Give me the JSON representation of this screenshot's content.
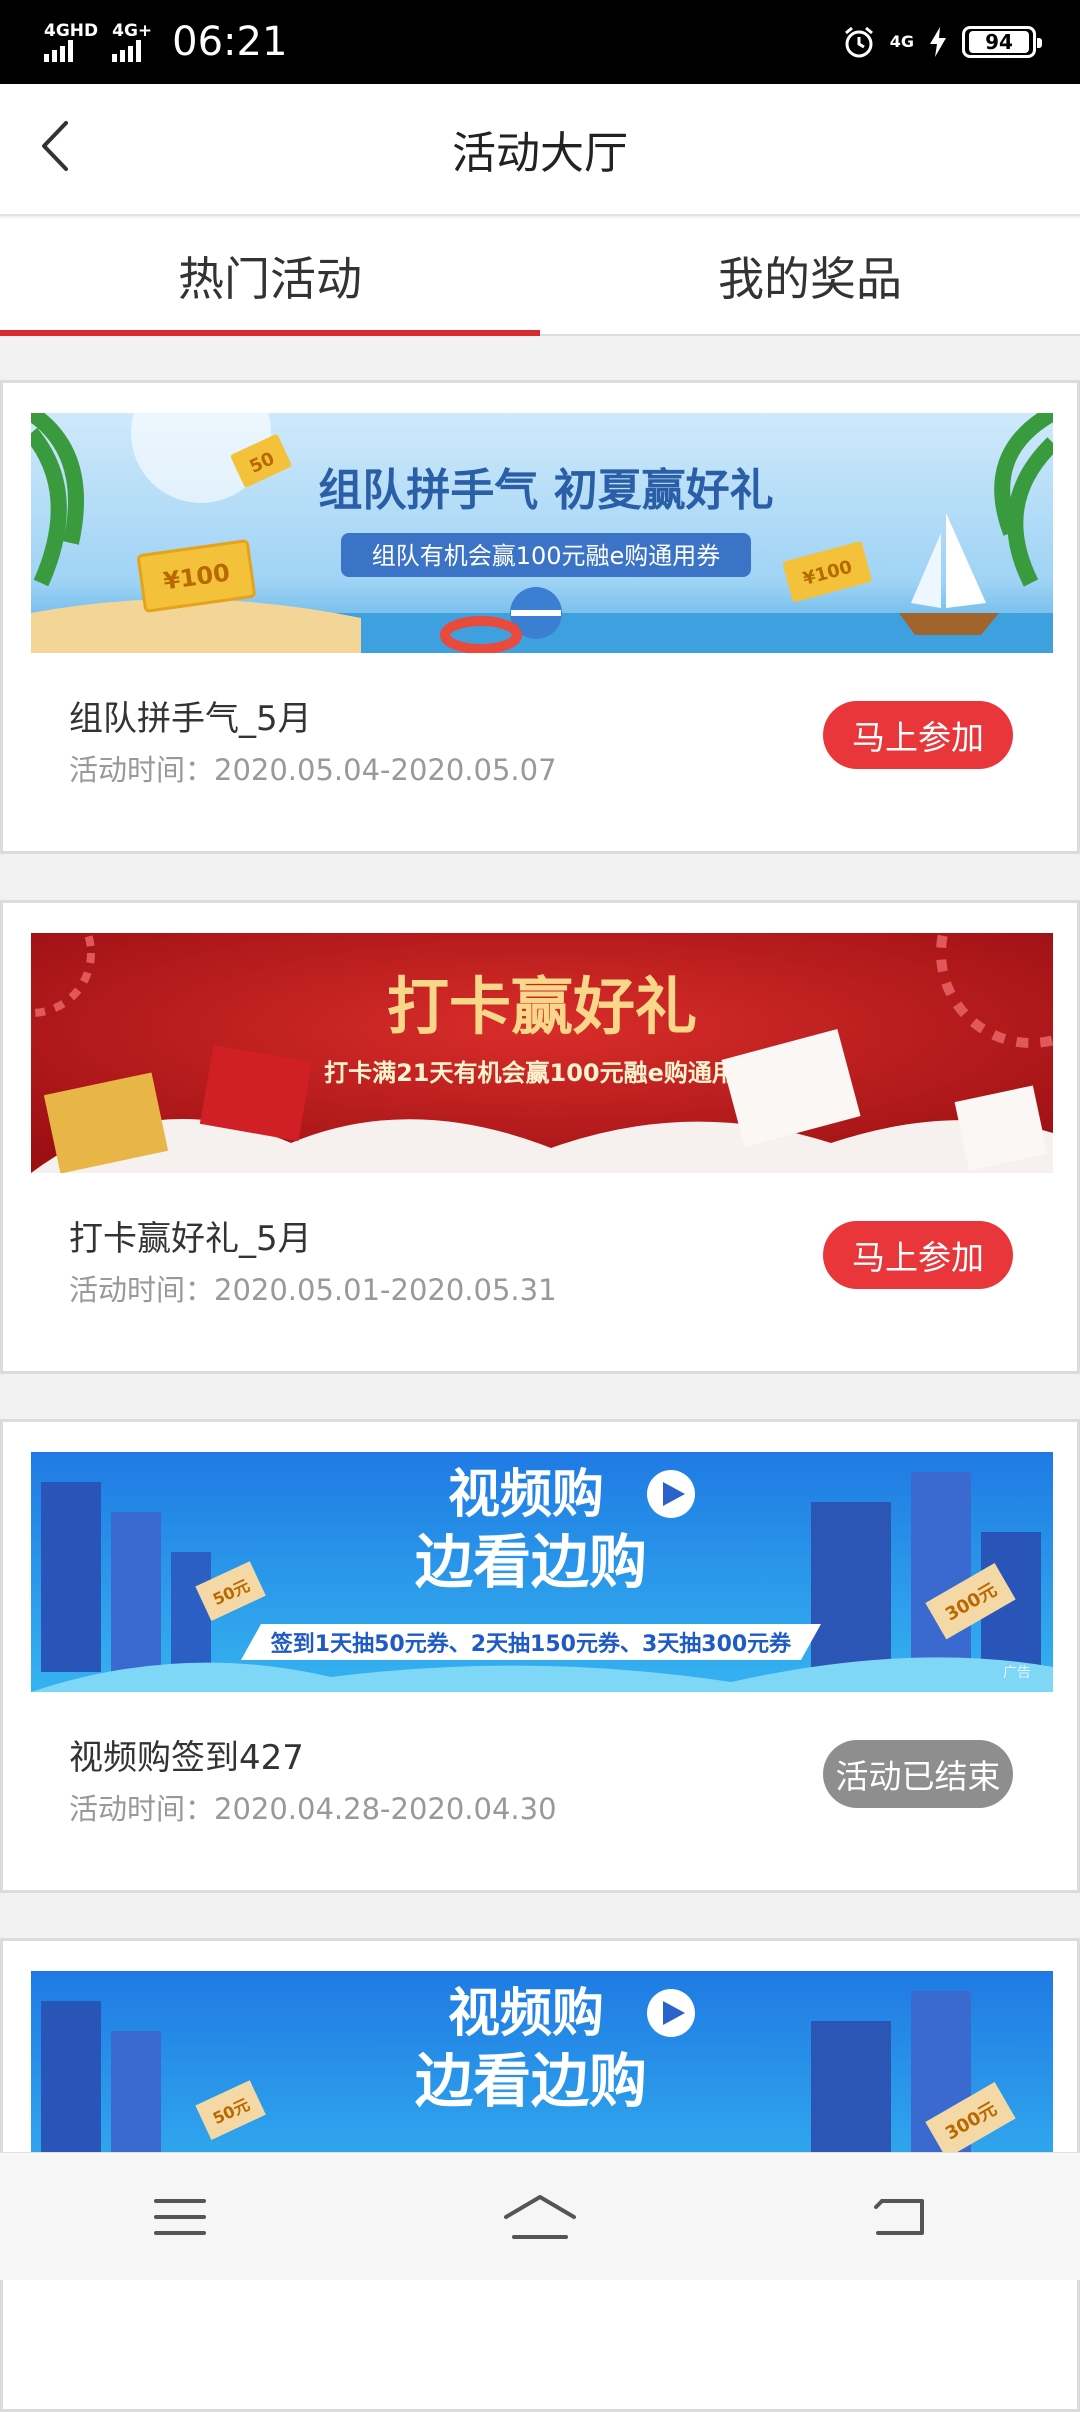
{
  "status_bar": {
    "signal1_label": "4GHD",
    "signal2_label": "4G+",
    "time": "06:21",
    "network_label": "4G",
    "battery": "94"
  },
  "header": {
    "title": "活动大厅",
    "back_icon": "chevron-left-icon"
  },
  "tabs": [
    {
      "label": "热门活动",
      "active": true
    },
    {
      "label": "我的奖品",
      "active": false
    }
  ],
  "activities": [
    {
      "banner": {
        "headline": "组队拼手气 初夏赢好礼",
        "subline": "组队有机会赢100元融e购通用券",
        "coupon_values": [
          "¥100",
          "50",
          "¥100"
        ],
        "theme": "beach"
      },
      "title": "组队拼手气_5月",
      "time_label": "活动时间：2020.05.04-2020.05.07",
      "button": "马上参加",
      "ended": false
    },
    {
      "banner": {
        "headline": "打卡赢好礼",
        "subline": "打卡满21天有机会赢100元融e购通用券",
        "theme": "red-gift"
      },
      "title": "打卡赢好礼_5月",
      "time_label": "活动时间：2020.05.01-2020.05.31",
      "button": "马上参加",
      "ended": false
    },
    {
      "banner": {
        "headline1": "视频购",
        "headline2": "边看边购",
        "subline": "签到1天抽50元券、2天抽150元券、3天抽300元券",
        "coupon_left": "50元",
        "coupon_right": "300元",
        "ad_tag": "广告",
        "theme": "city-blue"
      },
      "title": "视频购签到427",
      "time_label": "活动时间：2020.04.28-2020.04.30",
      "button": "活动已结束",
      "ended": true
    },
    {
      "banner": {
        "headline1": "视频购",
        "headline2": "边看边购",
        "coupon_left": "50元",
        "coupon_right": "300元",
        "theme": "city-blue"
      }
    }
  ],
  "bottom_nav": {
    "items": [
      "menu-icon",
      "home-icon",
      "back-icon"
    ]
  },
  "colors": {
    "accent": "#d92b2f",
    "join_button": "#e8363a",
    "ended_button": "#8e8e8e"
  }
}
